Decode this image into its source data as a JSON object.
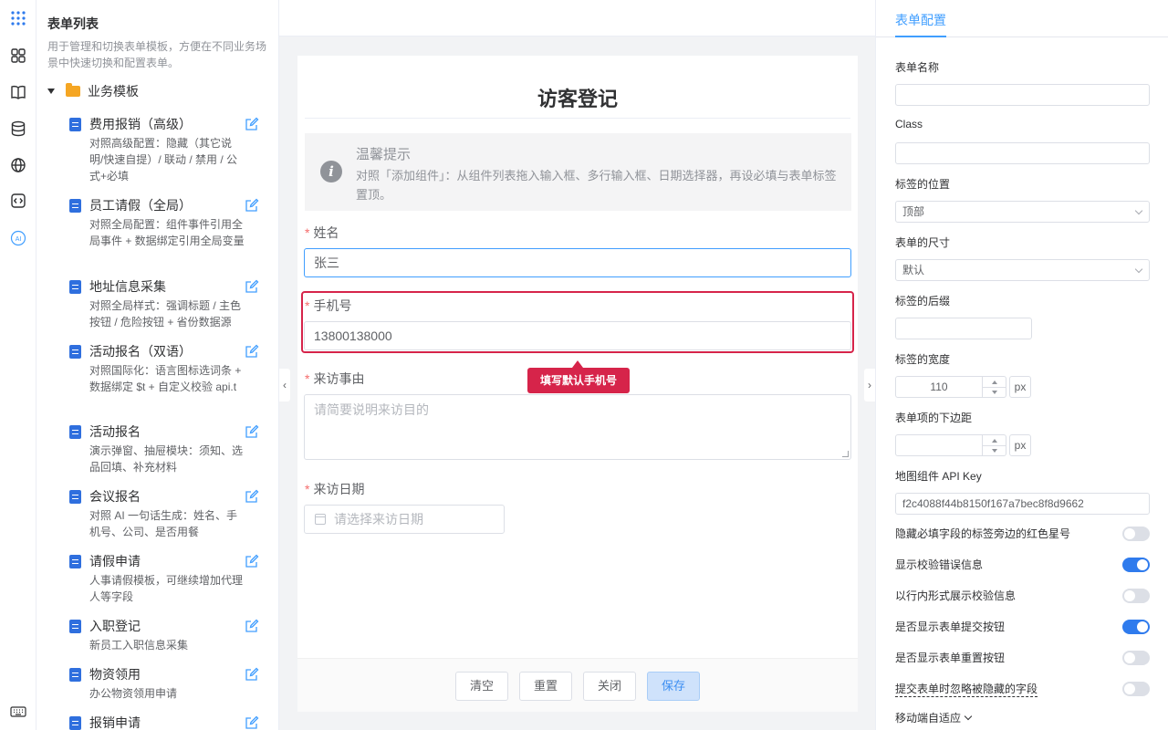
{
  "rail": {
    "icons": [
      "apps-grid-icon",
      "components-icon",
      "book-icon",
      "database-icon",
      "globe-icon",
      "code-icon",
      "ai-icon",
      "keyboard-icon"
    ],
    "ai_label": "AI"
  },
  "list_panel": {
    "title": "表单列表",
    "description": "用于管理和切换表单模板，方便在不同业务场景中快速切换和配置表单。",
    "folder": "业务模板",
    "items": [
      {
        "name": "费用报销（高级）",
        "desc": "对照高级配置：隐藏（其它说明/快速自提）/ 联动 / 禁用 / 公式+必填"
      },
      {
        "name": "员工请假（全局）",
        "desc": "对照全局配置：组件事件引用全局事件 + 数据绑定引用全局变量"
      },
      {
        "name": "地址信息采集",
        "desc": "对照全局样式：强调标题 / 主色按钮 / 危险按钮 + 省份数据源"
      },
      {
        "name": "活动报名（双语）",
        "desc": "对照国际化：语言图标选词条 + 数据绑定 $t + 自定义校验 api.t"
      },
      {
        "name": "活动报名",
        "desc": "演示弹窗、抽屉模块：须知、选品回填、补充材料"
      },
      {
        "name": "会议报名",
        "desc": "对照 AI 一句话生成：姓名、手机号、公司、是否用餐"
      },
      {
        "name": "请假申请",
        "desc": "人事请假模板，可继续增加代理人等字段"
      },
      {
        "name": "入职登记",
        "desc": "新员工入职信息采集"
      },
      {
        "name": "物资领用",
        "desc": "办公物资领用申请"
      },
      {
        "name": "报销申请",
        "desc": ""
      }
    ]
  },
  "canvas": {
    "form_title": "访客登记",
    "alert": {
      "title": "温馨提示",
      "body": "对照「添加组件」：从组件列表拖入输入框、多行输入框、日期选择器，再设必填与表单标签置顶。"
    },
    "required_mark": "*",
    "fields": {
      "name_label": "姓名",
      "name_value": "张三",
      "phone_label": "手机号",
      "phone_value": "13800138000",
      "reason_label": "来访事由",
      "reason_placeholder": "请简要说明来访目的",
      "date_label": "来访日期",
      "date_placeholder": "请选择来访日期"
    },
    "tooltip": "填写默认手机号",
    "buttons": {
      "clear": "清空",
      "reset": "重置",
      "close": "关闭",
      "save": "保存"
    },
    "collapse_left": "‹",
    "collapse_right": "›"
  },
  "config": {
    "tab": "表单配置",
    "form_name_label": "表单名称",
    "form_name_value": "",
    "class_label": "Class",
    "class_value": "",
    "label_position_label": "标签的位置",
    "label_position_value": "顶部",
    "size_label": "表单的尺寸",
    "size_value": "默认",
    "label_suffix_label": "标签的后缀",
    "label_suffix_value": "",
    "label_width_label": "标签的宽度",
    "label_width_value": "110",
    "label_width_unit": "px",
    "item_margin_label": "表单项的下边距",
    "item_margin_value": "",
    "item_margin_unit": "px",
    "map_key_label": "地图组件 API Key",
    "map_key_value": "f2c4088f44b8150f167a7bec8f8d9662",
    "switches": [
      {
        "label": "隐藏必填字段的标签旁边的红色星号",
        "on": false
      },
      {
        "label": "显示校验错误信息",
        "on": true
      },
      {
        "label": "以行内形式展示校验信息",
        "on": false
      },
      {
        "label": "是否显示表单提交按钮",
        "on": true
      },
      {
        "label": "是否显示表单重置按钮",
        "on": false
      },
      {
        "label": "提交表单时忽略被隐藏的字段",
        "on": false
      }
    ],
    "mobile_label": "移动端自适应"
  }
}
